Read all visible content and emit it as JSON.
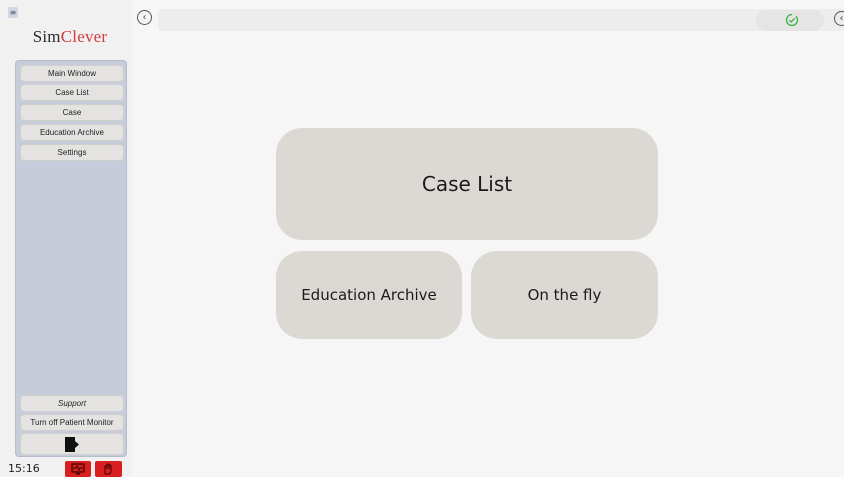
{
  "sidebar": {
    "menu_icon": "menu-icon",
    "brand": {
      "part1": "Sim",
      "part2": "Clever",
      "accent_color": "#d43b3b"
    },
    "nav_items": [
      {
        "label": "Main Window"
      },
      {
        "label": "Case List"
      },
      {
        "label": "Case"
      },
      {
        "label": "Education Archive"
      },
      {
        "label": "Settings"
      }
    ],
    "support_label": "Support",
    "patient_monitor_label": "Turn off Patient Monitor",
    "exit_icon": "exit-door-icon",
    "panel_color": "#c6ccd9"
  },
  "statusbar": {
    "time": "15:16",
    "alert_buttons": [
      {
        "icon": "monitor-alert-icon",
        "color": "#d81e1e"
      },
      {
        "icon": "hand-alert-icon",
        "color": "#d81e1e"
      }
    ]
  },
  "topbar": {
    "collapse_icon": "chevron-left-circle-icon",
    "status_icon": "check-circle-icon",
    "status_color": "#3bb14a",
    "edge_icon": "chevron-circle-icon"
  },
  "main": {
    "tiles": [
      {
        "label": "Case List"
      },
      {
        "label": "Education Archive"
      },
      {
        "label": "On the fly"
      }
    ],
    "tile_color": "#dcd9d4"
  }
}
